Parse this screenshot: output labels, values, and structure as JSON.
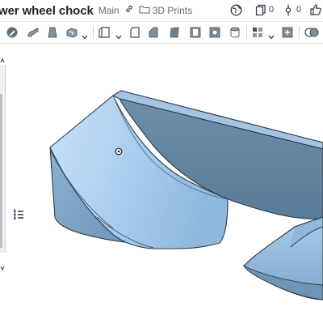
{
  "document": {
    "title": "wer wheel chock",
    "branch": "Main",
    "folder": "3D Prints"
  },
  "stats": {
    "copies": "0",
    "versions": "0"
  },
  "icons": {
    "link": "link-icon",
    "folder": "folder-icon",
    "globe": "globe-icon",
    "copy": "copy-icon",
    "version": "version-icon",
    "like": "thumbs-up-icon",
    "list": "feature-list-icon"
  },
  "toolbar": {
    "tools": [
      "sketch",
      "sweep",
      "loft",
      "extrude",
      "plane",
      "fillet",
      "chamfer",
      "draft",
      "shell",
      "hole",
      "thicken",
      "pattern",
      "boolean"
    ]
  },
  "colors": {
    "part_light": "#b8d8f4",
    "part_mid": "#8fb8dc",
    "part_dark": "#587c99",
    "edge": "#2c3b48",
    "accent": "#1e5fa8"
  }
}
